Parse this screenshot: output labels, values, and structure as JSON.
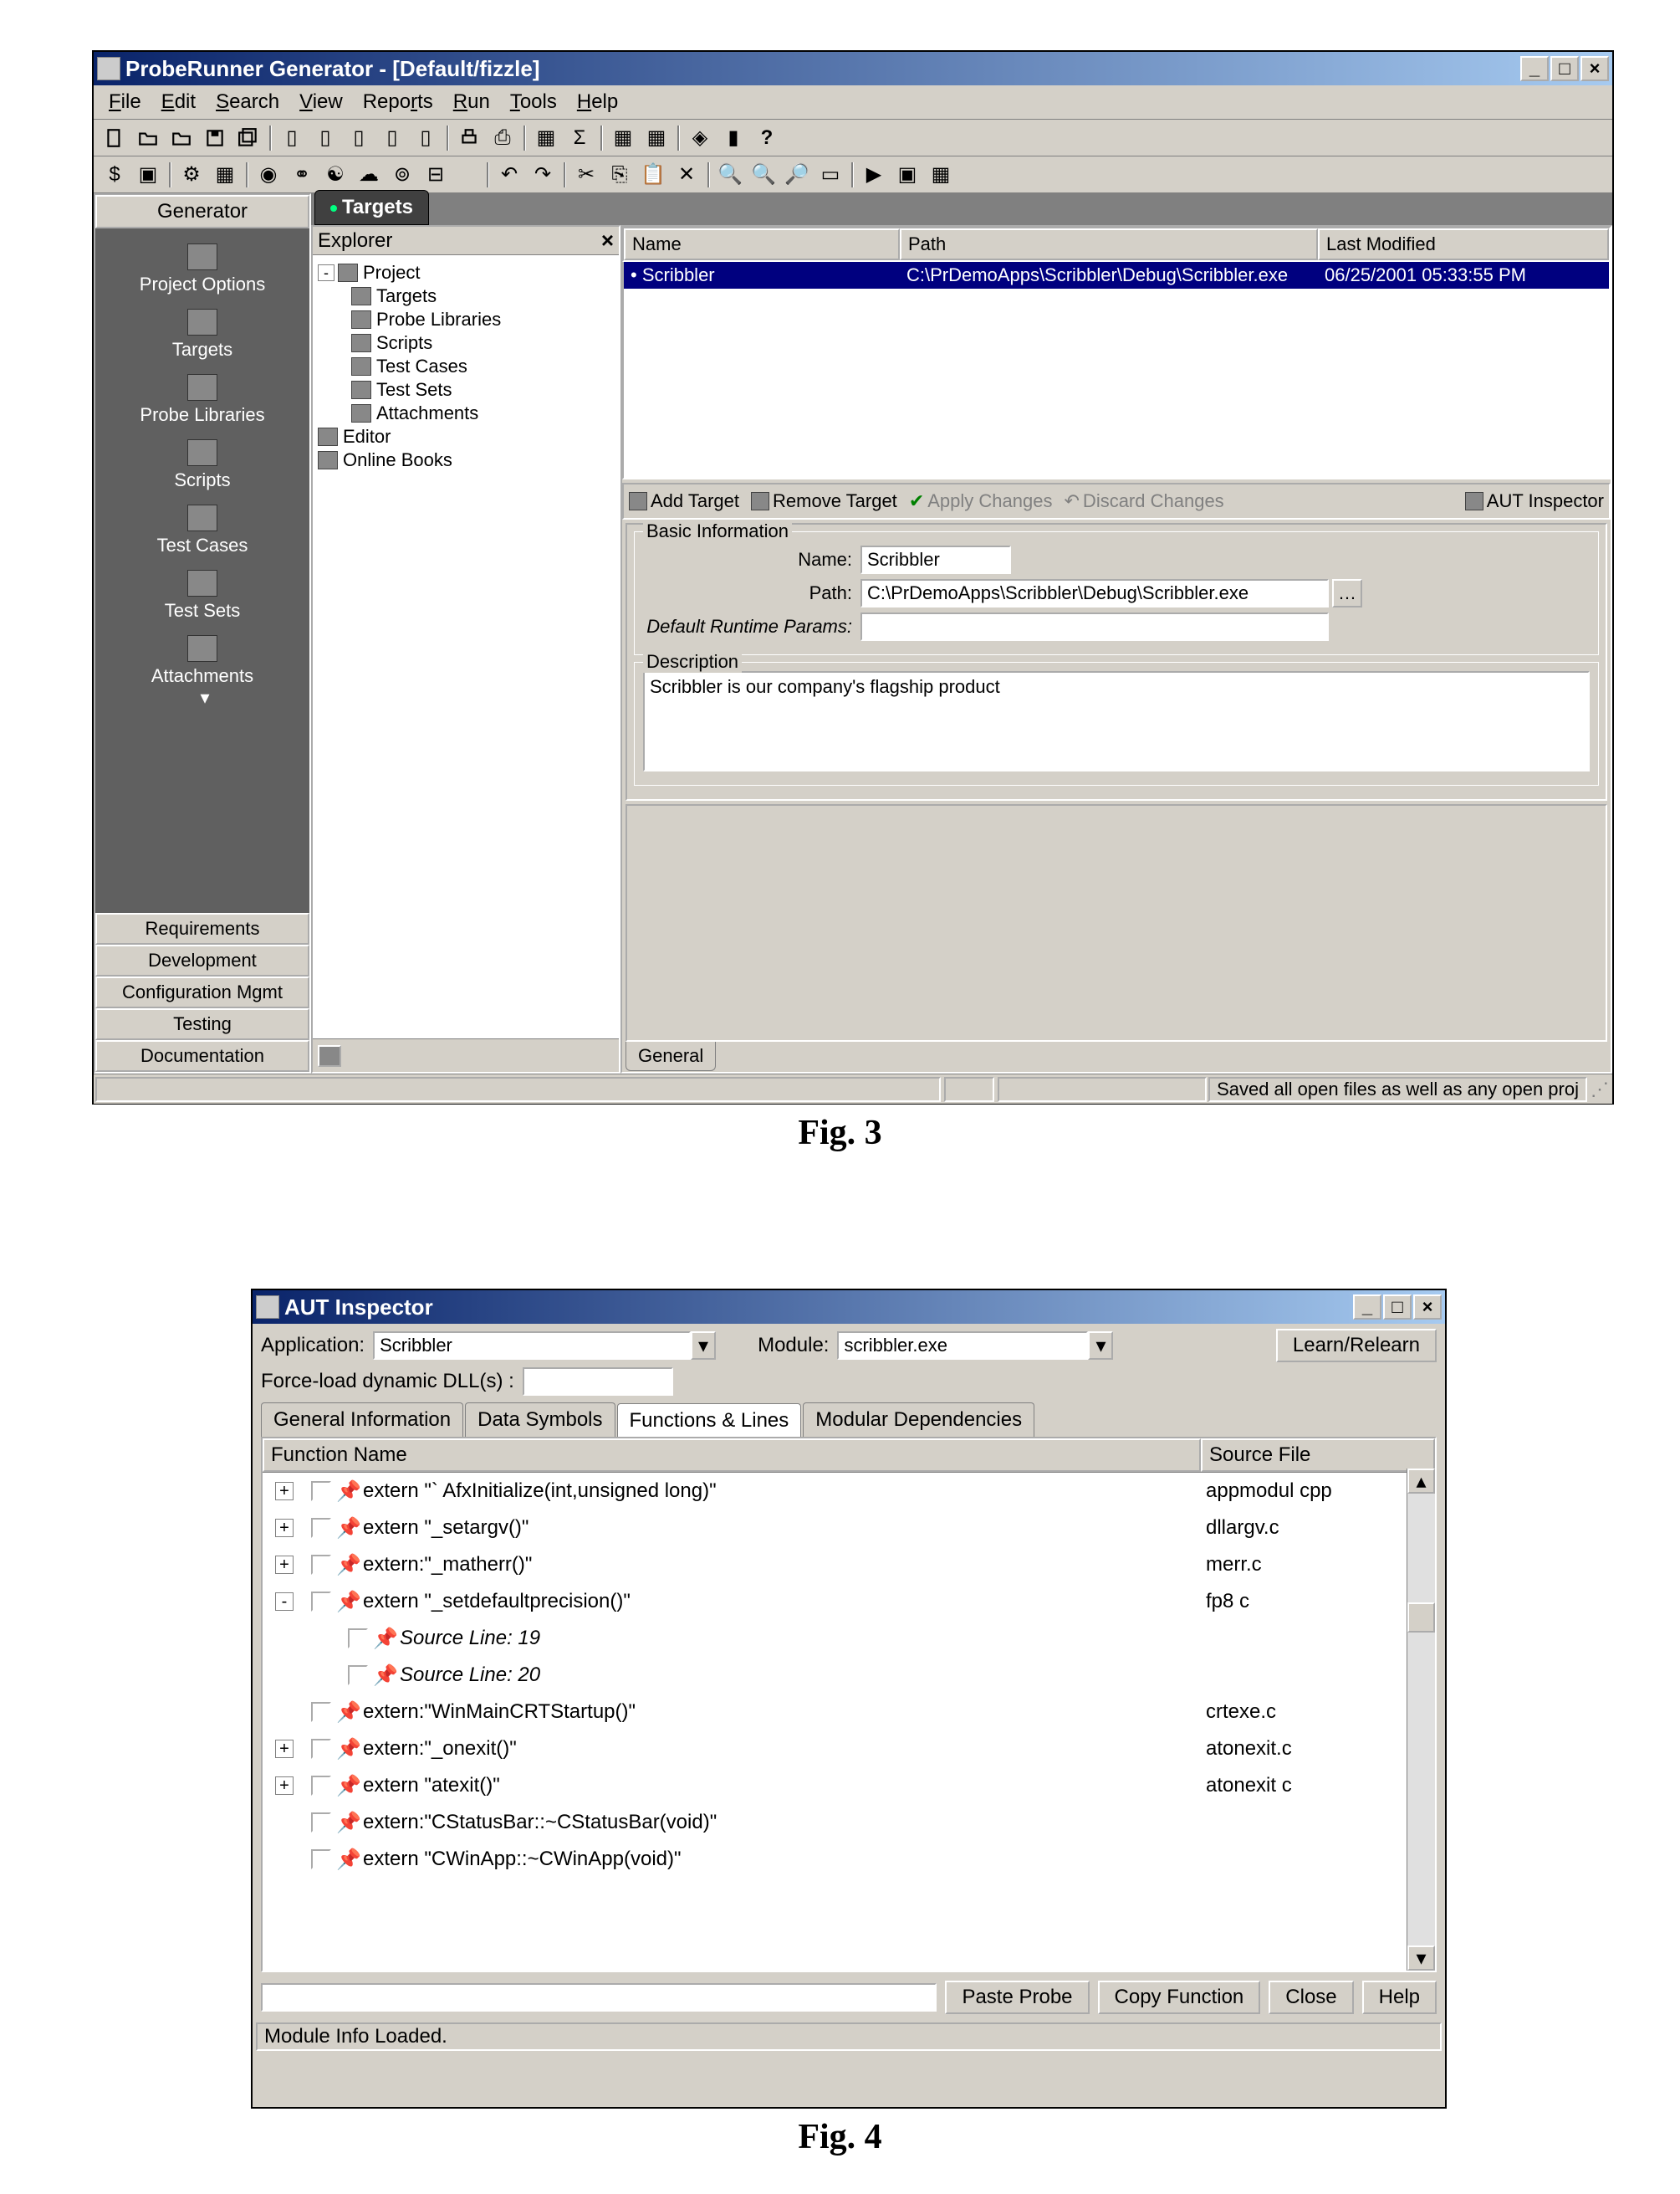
{
  "fig3": {
    "title": "ProbeRunner Generator - [Default/fizzle]",
    "menu": [
      "File",
      "Edit",
      "Search",
      "View",
      "Reports",
      "Run",
      "Tools",
      "Help"
    ],
    "sidebar": {
      "header": "Generator",
      "items": [
        "Project Options",
        "Targets",
        "Probe Libraries",
        "Scripts",
        "Test Cases",
        "Test Sets",
        "Attachments"
      ],
      "bottom": [
        "Requirements",
        "Development",
        "Configuration Mgmt",
        "Testing",
        "Documentation"
      ]
    },
    "tab": "Targets",
    "explorer": {
      "title": "Explorer",
      "root": "Project",
      "children": [
        "Targets",
        "Probe Libraries",
        "Scripts",
        "Test Cases",
        "Test Sets",
        "Attachments"
      ],
      "after": [
        "Editor",
        "Online Books"
      ]
    },
    "list": {
      "cols": [
        "Name",
        "Path",
        "Last Modified"
      ],
      "row": {
        "name": "Scribbler",
        "path": "C:\\PrDemoApps\\Scribbler\\Debug\\Scribbler.exe",
        "mod": "06/25/2001 05:33:55 PM"
      }
    },
    "actions": {
      "add": "Add Target",
      "remove": "Remove Target",
      "apply": "Apply Changes",
      "discard": "Discard Changes",
      "inspect": "AUT Inspector"
    },
    "form": {
      "basic_legend": "Basic Information",
      "name_label": "Name:",
      "name": "Scribbler",
      "path_label": "Path:",
      "path": "C:\\PrDemoApps\\Scribbler\\Debug\\Scribbler.exe",
      "params_label": "Default Runtime Params:",
      "params": "",
      "desc_legend": "Description",
      "desc": "Scribbler is our company's flagship product"
    },
    "bottom_tab": "General",
    "status": "Saved all open files as well as any open proj",
    "caption": "Fig. 3"
  },
  "fig4": {
    "title": "AUT Inspector",
    "app_label": "Application:",
    "app": "Scribbler",
    "mod_label": "Module:",
    "mod": "scribbler.exe",
    "learn": "Learn/Relearn",
    "dll_label": "Force-load dynamic DLL(s) :",
    "dll": "",
    "tabs": [
      "General Information",
      "Data Symbols",
      "Functions & Lines",
      "Modular Dependencies"
    ],
    "active_tab": 2,
    "cols": {
      "fn": "Function Name",
      "sf": "Source File"
    },
    "rows": [
      {
        "exp": "+",
        "fn": "extern \"` AfxInitialize(int,unsigned long)\"",
        "sf": "appmodul cpp"
      },
      {
        "exp": "+",
        "fn": "extern \"_setargv()\"",
        "sf": "dllargv.c"
      },
      {
        "exp": "+",
        "fn": "extern:\"_matherr()\"",
        "sf": "merr.c"
      },
      {
        "exp": "-",
        "fn": "extern \"_setdefaultprecision()\"",
        "sf": "fp8 c"
      },
      {
        "child": true,
        "fn": "Source Line: 19",
        "sf": ""
      },
      {
        "child": true,
        "fn": "Source Line: 20",
        "sf": ""
      },
      {
        "exp": "",
        "fn": "extern:\"WinMainCRTStartup()\"",
        "sf": "crtexe.c"
      },
      {
        "exp": "+",
        "fn": "extern:\"_onexit()\"",
        "sf": "atonexit.c"
      },
      {
        "exp": "+",
        "fn": "extern \"atexit()\"",
        "sf": "atonexit c"
      },
      {
        "exp": "",
        "fn": "extern:\"CStatusBar::~CStatusBar(void)\"",
        "sf": ""
      },
      {
        "exp": "",
        "fn": "extern \"CWinApp::~CWinApp(void)\"",
        "sf": ""
      }
    ],
    "buttons": {
      "paste": "Paste Probe",
      "copy": "Copy Function",
      "close": "Close",
      "help": "Help"
    },
    "status": "Module Info Loaded.",
    "caption": "Fig. 4"
  }
}
